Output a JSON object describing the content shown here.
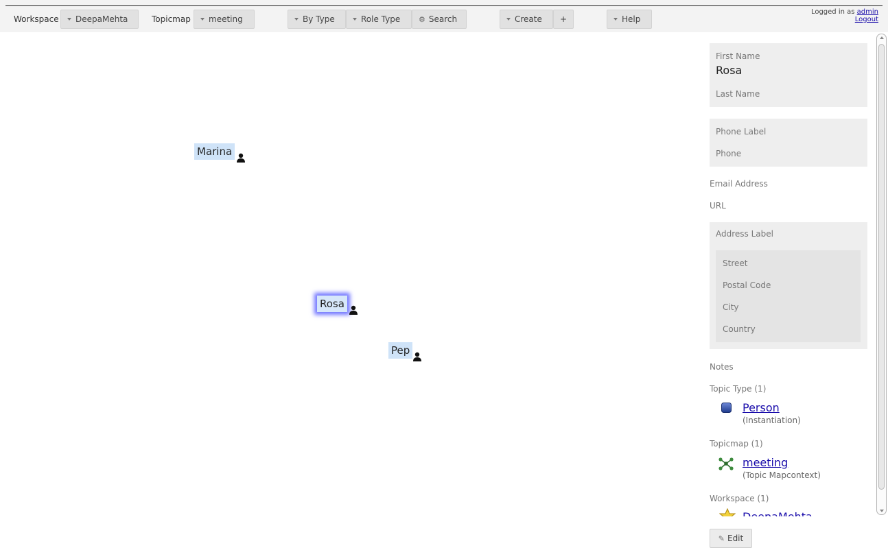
{
  "toolbar": {
    "workspace_label": "Workspace",
    "workspace_value": "DeepaMehta",
    "topicmap_label": "Topicmap",
    "topicmap_value": "meeting",
    "by_type": "By Type",
    "role_type": "Role Type",
    "search": "Search",
    "create": "Create",
    "add": "+",
    "help": "Help"
  },
  "login": {
    "prefix": "Logged in as",
    "user": "admin",
    "logout": "Logout"
  },
  "canvas": {
    "topics": [
      {
        "label": "Marina",
        "icon": "person-icon",
        "selected": false
      },
      {
        "label": "Rosa",
        "icon": "person-icon",
        "selected": true
      },
      {
        "label": "Pep",
        "icon": "person-icon",
        "selected": false
      }
    ]
  },
  "detail": {
    "first_name_label": "First Name",
    "first_name_value": "Rosa",
    "last_name_label": "Last Name",
    "phone_label_label": "Phone Label",
    "phone_label": "Phone",
    "email_label": "Email Address",
    "url_label": "URL",
    "address_label_label": "Address Label",
    "street_label": "Street",
    "postal_code_label": "Postal Code",
    "city_label": "City",
    "country_label": "Country",
    "notes_label": "Notes",
    "topic_type_header": "Topic Type (1)",
    "topic_type_link": "Person",
    "topic_type_sub": "(Instantiation)",
    "topicmap_header": "Topicmap (1)",
    "topicmap_link": "meeting",
    "topicmap_sub": "(Topic Mapcontext)",
    "workspace_header": "Workspace (1)",
    "workspace_link": "DeepaMehta",
    "edit_button": "Edit"
  },
  "colors": {
    "accent_link": "#1a0dab",
    "topic_bg": "#cfe3f8",
    "selection_glow": "#6f73ff",
    "person_type_icon": "#2e4fa3",
    "topicmap_icon": "#3c8a3c",
    "workspace_icon": "#f2d23c"
  }
}
